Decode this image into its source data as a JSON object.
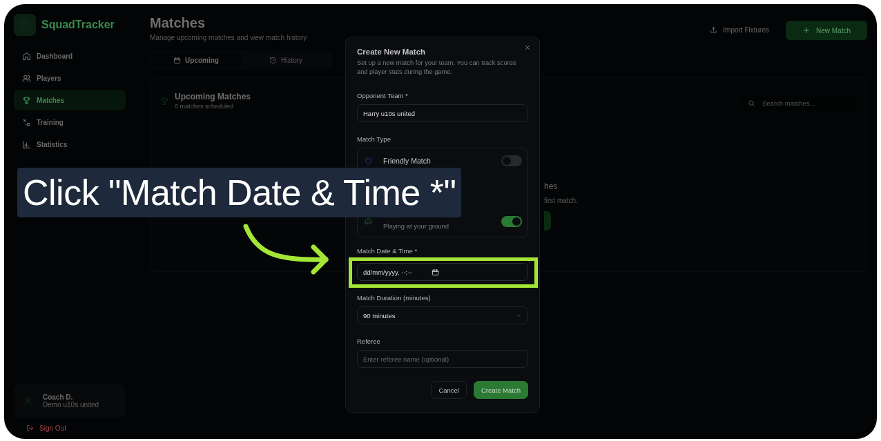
{
  "app": {
    "name": "SquadTracker"
  },
  "sidebar": {
    "items": [
      {
        "label": "Dashboard",
        "selected": false
      },
      {
        "label": "Players",
        "selected": false
      },
      {
        "label": "Matches",
        "selected": true
      },
      {
        "label": "Training",
        "selected": false
      },
      {
        "label": "Statistics",
        "selected": false
      }
    ],
    "user": {
      "name": "Coach D.",
      "team": "Demo u10s united"
    },
    "sign_out": "Sign Out"
  },
  "header": {
    "title": "Matches",
    "subtitle": "Manage upcoming matches and view match history",
    "actions": [
      {
        "kind": "outline",
        "label": "Import Fixtures"
      },
      {
        "kind": "primary",
        "label": "New Match"
      }
    ]
  },
  "tabs": [
    {
      "label": "Upcoming",
      "selected": true
    },
    {
      "label": "History",
      "selected": false
    }
  ],
  "matches_panel": {
    "title": "Upcoming Matches",
    "count": "0 matches scheduled",
    "search": {
      "placeholder": "Search matches..."
    },
    "empty_state": {
      "title": "hes",
      "text": "first match."
    }
  },
  "dialog": {
    "title": "Create New Match",
    "description": "Set up a new match for your team. You can track scores and player stats during the game.",
    "fields": [
      {
        "kind": "text",
        "label": "Opponent Team *",
        "value": "Harry u10s united"
      },
      {
        "kind": "match_type",
        "label": "Match Type",
        "options": [
          {
            "title": "Friendly Match",
            "on": false
          },
          {
            "description": "Playing at your ground",
            "on": true
          }
        ]
      },
      {
        "kind": "datetime",
        "label": "Match Date & Time *",
        "placeholder": "dd/mm/yyyy, --:--"
      },
      {
        "kind": "select",
        "label": "Match Duration (minutes)",
        "value": "90 minutes"
      },
      {
        "kind": "text",
        "label": "Referee",
        "placeholder": "Enter referee name (optional)"
      }
    ],
    "buttons": [
      {
        "kind": "secondary",
        "label": "Cancel"
      },
      {
        "kind": "primary",
        "label": "Create Match"
      }
    ]
  },
  "callout": {
    "text": "Click \"Match Date & Time *\""
  }
}
